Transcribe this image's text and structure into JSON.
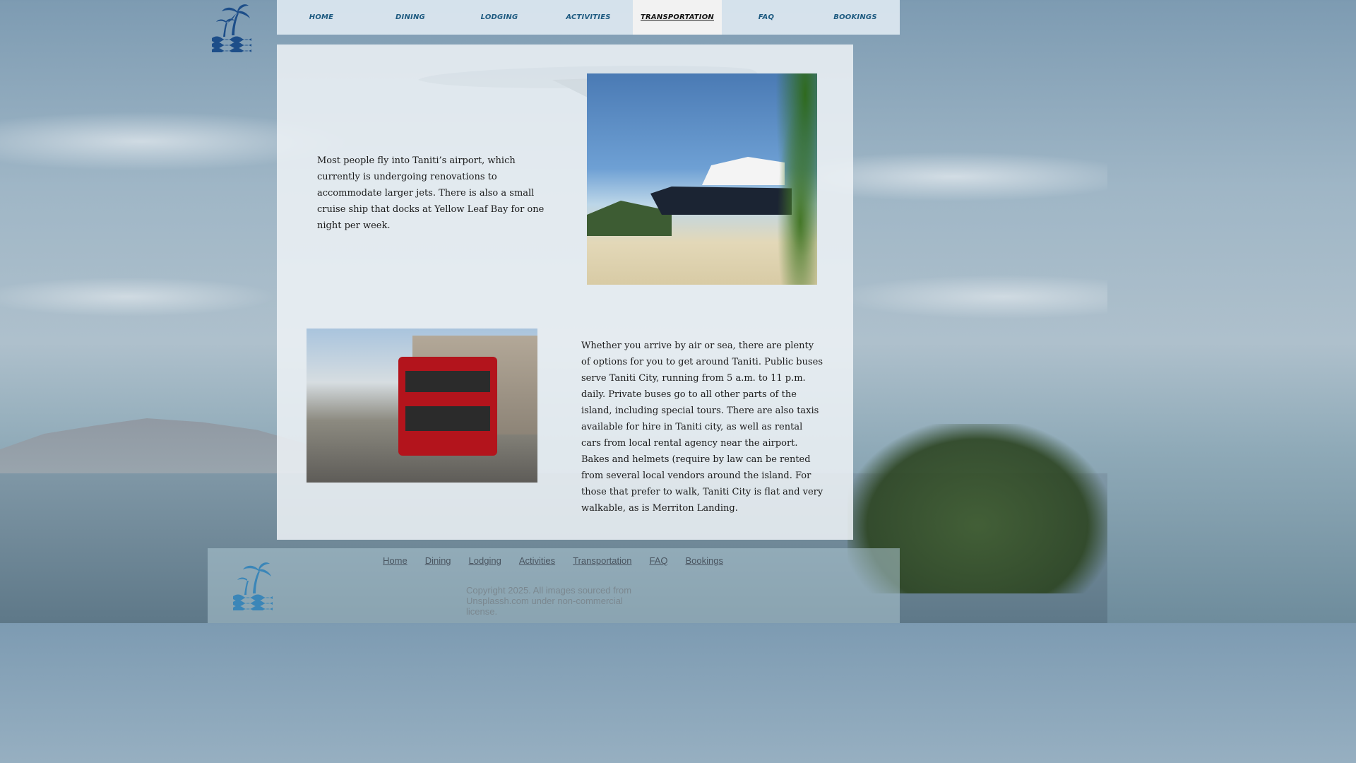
{
  "nav": {
    "items": [
      {
        "label": "Home"
      },
      {
        "label": "Dining"
      },
      {
        "label": "Lodging"
      },
      {
        "label": "Activities"
      },
      {
        "label": "Transportation",
        "active": true
      },
      {
        "label": "FAQ"
      },
      {
        "label": "Bookings"
      }
    ]
  },
  "logo": {
    "icon": "palm-tree-waves-icon",
    "color": "#1d4e89"
  },
  "content": {
    "paragraph1": "Most people fly into Taniti’s airport, which currently is undergoing renovations to accommodate larger jets. There is also a small cruise ship that docks at Yellow Leaf Bay for one night per week.",
    "paragraph2": "Whether you arrive by air or sea, there are plenty of options for you to get around Taniti. Public buses serve Taniti City, running from 5 a.m. to 11 p.m. daily. Private buses go to all other parts of the island, including special tours. There are also taxis available for hire in Taniti city, as well as rental cars from local rental agency near the airport. Bakes and helmets (require by law  can be rented from several local vendors around the island. For those that prefer to walk, Taniti City is flat and very walkable, as is Merriton Landing.",
    "images": [
      "cruise-ship-photo",
      "red-double-decker-bus-photo"
    ]
  },
  "footer": {
    "links": [
      "Home",
      "Dining",
      "Lodging",
      "Activities",
      "Transportation",
      "FAQ",
      "Bookings"
    ],
    "copyright": "Copyright 2025. All images sourced from Unsplassh.com under non-commercial license."
  },
  "colors": {
    "accent": "#1d5a80",
    "active_tab_bg": "#f2f2f2"
  }
}
